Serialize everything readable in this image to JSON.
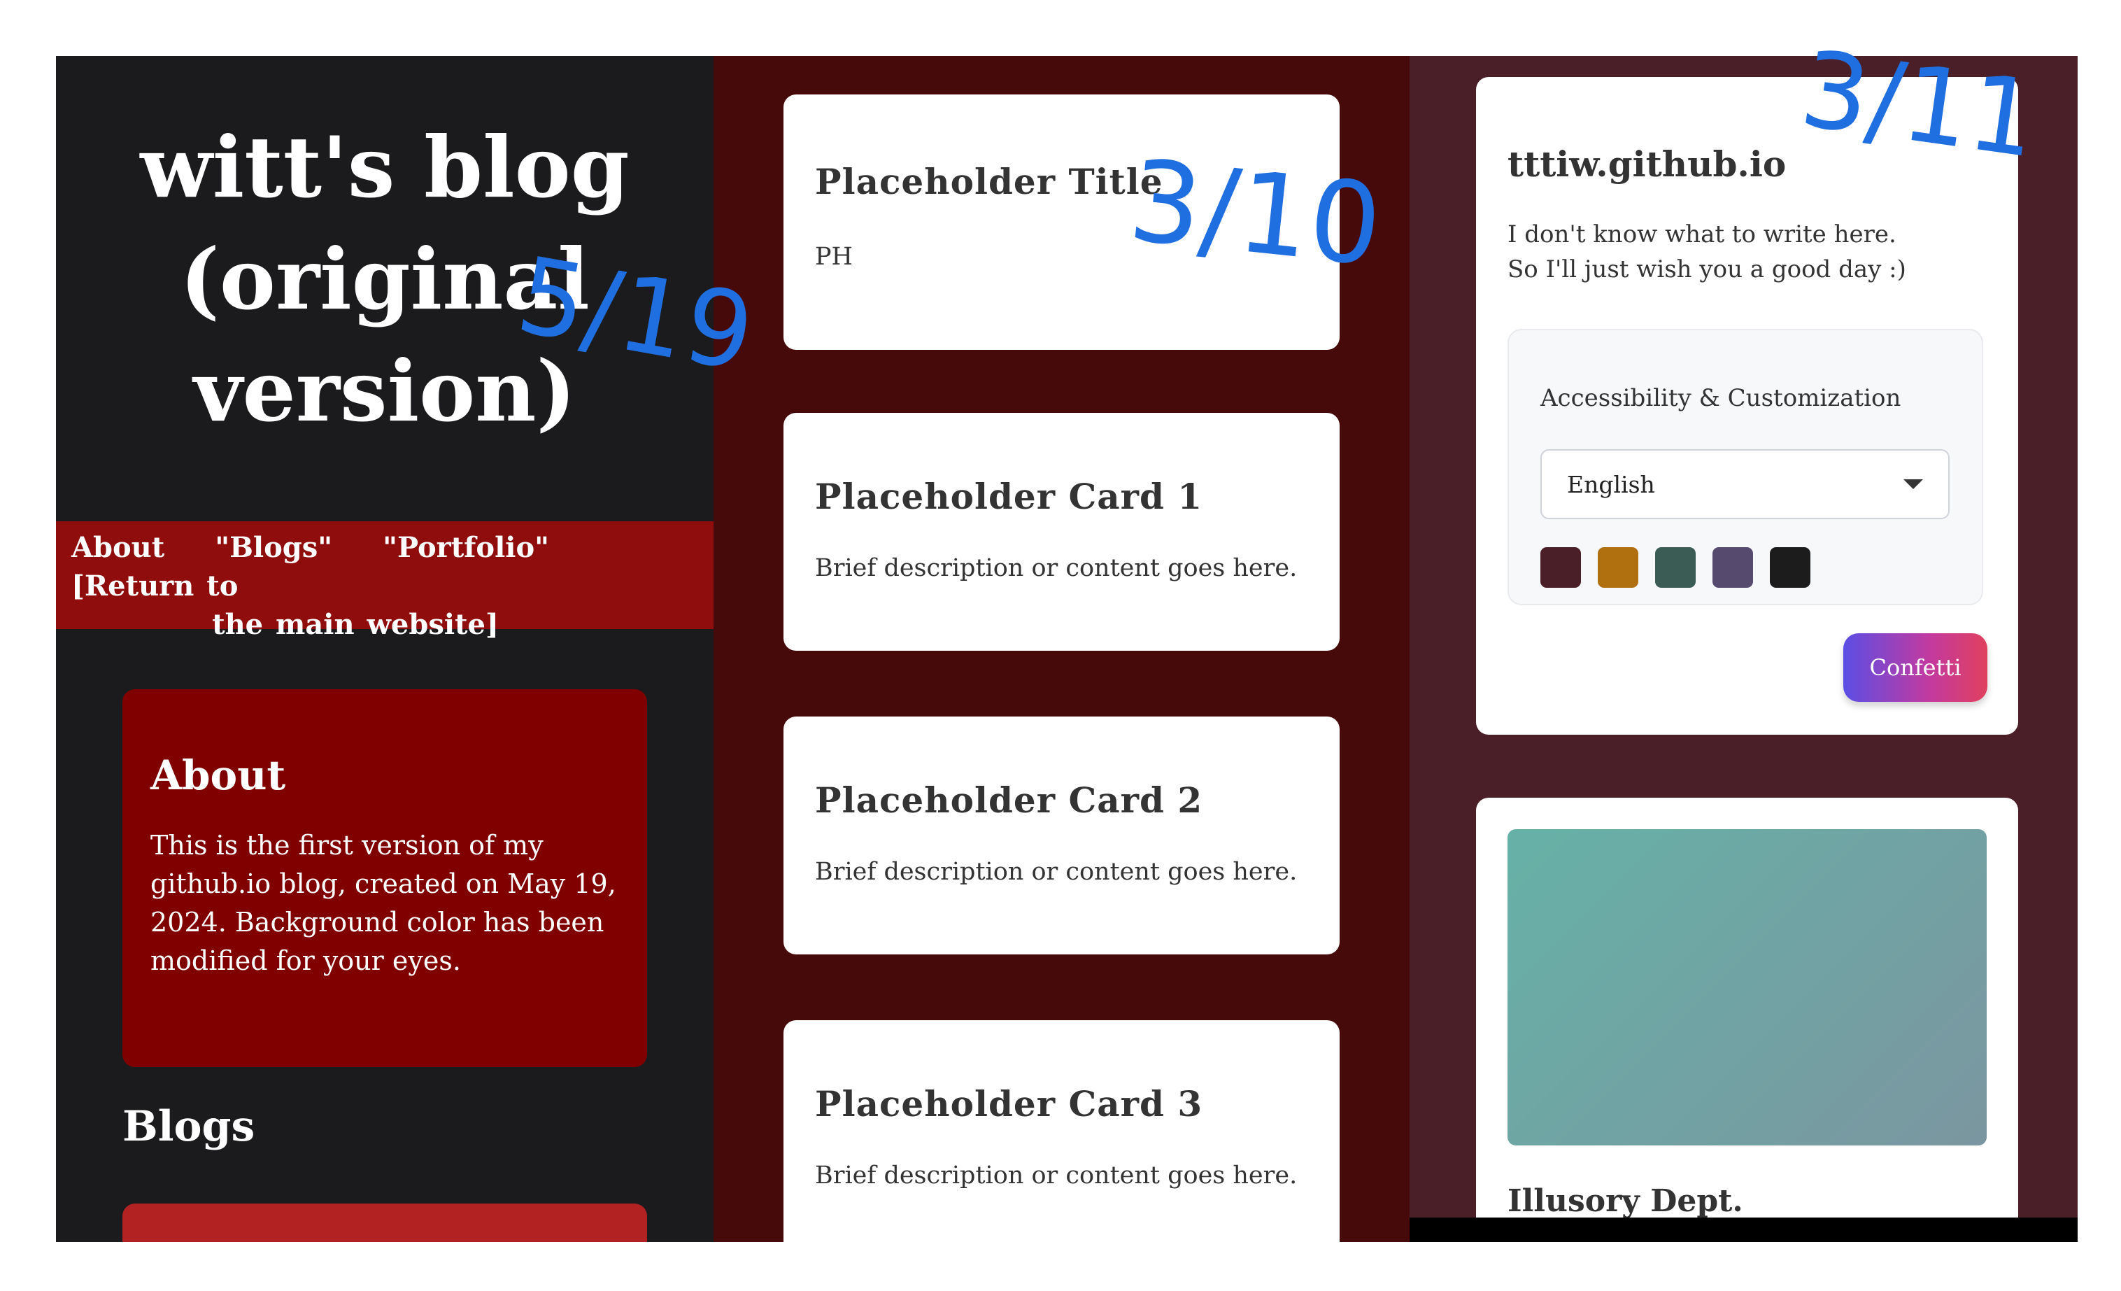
{
  "left_column": {
    "site_title": "witt's blog (original version)",
    "annotation": "5/19",
    "nav": {
      "about": "About",
      "blogs": "\"Blogs\"",
      "portfolio": "\"Portfolio\"",
      "return_part1": "[Return to",
      "return_part2": "the main website]"
    },
    "about_box": {
      "heading": "About",
      "text": "This is the first version of my github.io blog, created on May 19, 2024. Background color has been modified for your eyes."
    },
    "blogs_heading": "Blogs"
  },
  "middle_column": {
    "annotation": "3/10",
    "cards": [
      {
        "title": "Placeholder Title",
        "text": "PH"
      },
      {
        "title": "Placeholder Card 1",
        "text": "Brief description or content goes here."
      },
      {
        "title": "Placeholder Card 2",
        "text": "Brief description or content goes here."
      },
      {
        "title": "Placeholder Card 3",
        "text": "Brief description or content goes here."
      }
    ]
  },
  "right_column": {
    "annotation": "3/11",
    "profile": {
      "title": "tttiw.github.io",
      "intro_line1": "I don't know what to write here.",
      "intro_line2": "So I'll just wish you a good day :)"
    },
    "accessibility": {
      "title": "Accessibility & Customization",
      "language_selected": "English",
      "swatch_colors": [
        "#4a1f27",
        "#b07010",
        "#3b5b55",
        "#564a6e",
        "#1c1c1c"
      ]
    },
    "confetti_button": "Confetti",
    "dept_title": "Illusory Dept."
  },
  "colors": {
    "left_bg": "#1b1b1d",
    "nav_bg": "#900d0d",
    "about_bg": "#800000",
    "middle_bg": "#470a0a",
    "right_bg": "#4a1f27",
    "annotation": "#1f6fe0"
  }
}
